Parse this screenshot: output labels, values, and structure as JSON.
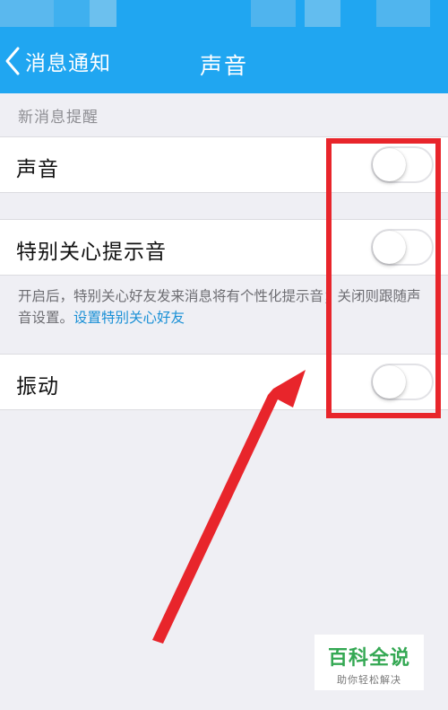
{
  "nav": {
    "back_label": "消息通知",
    "title": "声音"
  },
  "section": {
    "header": "新消息提醒"
  },
  "settings": [
    {
      "label": "声音",
      "enabled": false
    },
    {
      "label": "特别关心提示音",
      "enabled": false
    },
    {
      "label": "振动",
      "enabled": false
    }
  ],
  "description": {
    "text": "开启后，特别关心好友发来消息将有个性化提示音；关闭则跟随声音设置。",
    "link": "设置特别关心好友"
  },
  "watermark": {
    "logo_text": "百科全说",
    "slogan": "助你轻松解决"
  },
  "colors": {
    "nav_bar": "#20a6f1",
    "background": "#efeff4",
    "link": "#1a90d6",
    "annotation_red": "#e8252b",
    "watermark_green": "#34a853"
  }
}
